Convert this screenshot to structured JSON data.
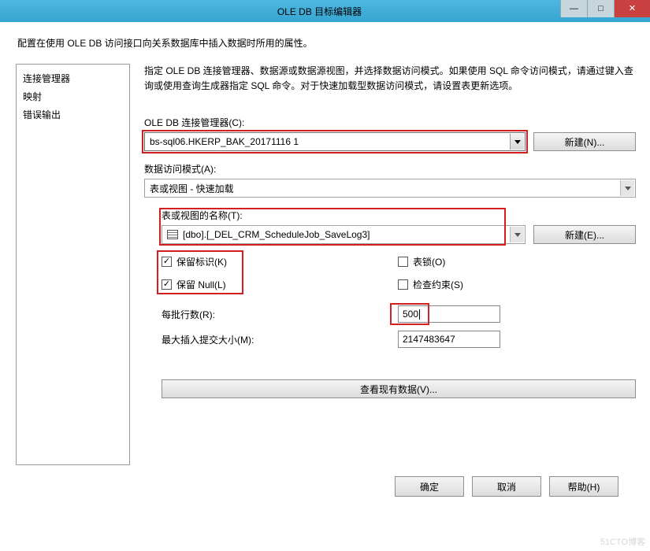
{
  "window": {
    "title": "OLE DB 目标编辑器",
    "minimize": "—",
    "maximize": "□",
    "close": "✕"
  },
  "intro": "配置在使用 OLE DB 访问接口向关系数据库中插入数据时所用的属性。",
  "sidebar": {
    "items": [
      {
        "label": "连接管理器"
      },
      {
        "label": "映射"
      },
      {
        "label": "错误输出"
      }
    ]
  },
  "content": {
    "desc": "指定 OLE DB 连接管理器、数据源或数据源视图，并选择数据访问模式。如果使用 SQL 命令访问模式，请通过键入查询或使用查询生成器指定 SQL 命令。对于快速加载型数据访问模式，请设置表更新选项。",
    "conn_mgr_label": "OLE DB 连接管理器(C):",
    "conn_mgr_value": "bs-sql06.HKERP_BAK_20171116 1",
    "new_n": "新建(N)...",
    "access_mode_label": "数据访问模式(A):",
    "access_mode_value": "表或视图 - 快速加载",
    "table_name_label": "表或视图的名称(T):",
    "table_name_value": "[dbo].[_DEL_CRM_ScheduleJob_SaveLog3]",
    "new_e": "新建(E)...",
    "keep_identity": "保留标识(K)",
    "keep_null": "保留 Null(L)",
    "table_lock": "表锁(O)",
    "check_constraints": "检查约束(S)",
    "rows_per_batch_label": "每批行数(R):",
    "rows_per_batch_value": "500",
    "max_commit_label": "最大插入提交大小(M):",
    "max_commit_value": "2147483647",
    "view_existing": "查看现有数据(V)..."
  },
  "footer": {
    "ok": "确定",
    "cancel": "取消",
    "help": "帮助(H)"
  },
  "watermark": "51CTO博客"
}
